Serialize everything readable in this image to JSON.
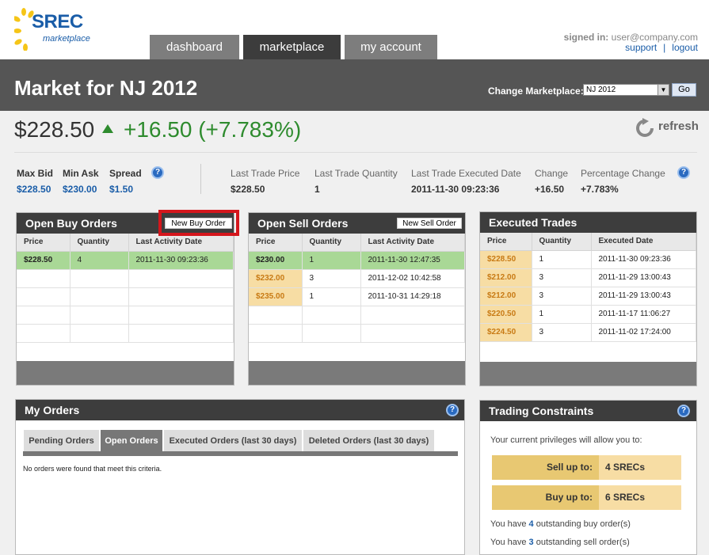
{
  "logo": {
    "text1": "SREC",
    "text2": "marketplace"
  },
  "nav": {
    "tabs": [
      {
        "label": "dashboard",
        "active": false
      },
      {
        "label": "marketplace",
        "active": true
      },
      {
        "label": "my account",
        "active": false
      }
    ]
  },
  "user": {
    "signed_in_label": "signed in:",
    "email": "user@company.com",
    "support": "support",
    "separator": "|",
    "logout": "logout"
  },
  "market": {
    "title": "Market for NJ 2012",
    "change_label": "Change Marketplace:",
    "selected_market": "NJ 2012",
    "go_label": "Go",
    "price": "$228.50",
    "change": "+16.50 (+7.783%)",
    "refresh_label": "refresh"
  },
  "stats": {
    "max_bid_label": "Max Bid",
    "max_bid": "$228.50",
    "min_ask_label": "Min Ask",
    "min_ask": "$230.00",
    "spread_label": "Spread",
    "spread": "$1.50",
    "last_trade_price_label": "Last Trade Price",
    "last_trade_price": "$228.50",
    "last_trade_qty_label": "Last Trade Quantity",
    "last_trade_qty": "1",
    "last_trade_date_label": "Last Trade Executed Date",
    "last_trade_date": "2011-11-30 09:23:36",
    "change_label": "Change",
    "change": "+16.50",
    "pct_change_label": "Percentage Change",
    "pct_change": "+7.783%",
    "help": "?"
  },
  "buy_orders": {
    "title": "Open Buy Orders",
    "button": "New Buy Order",
    "columns": [
      "Price",
      "Quantity",
      "Last Activity Date"
    ],
    "rows": [
      [
        "$228.50",
        "4",
        "2011-11-30 09:23:36"
      ]
    ]
  },
  "sell_orders": {
    "title": "Open Sell Orders",
    "button": "New Sell Order",
    "columns": [
      "Price",
      "Quantity",
      "Last Activity Date"
    ],
    "rows": [
      [
        "$230.00",
        "1",
        "2011-11-30 12:47:35"
      ],
      [
        "$232.00",
        "3",
        "2011-12-02 10:42:58"
      ],
      [
        "$235.00",
        "1",
        "2011-10-31 14:29:18"
      ]
    ]
  },
  "executed": {
    "title": "Executed Trades",
    "columns": [
      "Price",
      "Quantity",
      "Executed Date"
    ],
    "rows": [
      [
        "$228.50",
        "1",
        "2011-11-30 09:23:36"
      ],
      [
        "$212.00",
        "3",
        "2011-11-29 13:00:43"
      ],
      [
        "$212.00",
        "3",
        "2011-11-29 13:00:43"
      ],
      [
        "$220.50",
        "1",
        "2011-11-17 11:06:27"
      ],
      [
        "$224.50",
        "3",
        "2011-11-02 17:24:00"
      ]
    ]
  },
  "my_orders": {
    "title": "My Orders",
    "tabs": [
      "Pending Orders",
      "Open Orders",
      "Executed Orders (last 30 days)",
      "Deleted Orders (last 30 days)"
    ],
    "empty": "No orders were found that meet this criteria."
  },
  "constraints": {
    "title": "Trading Constraints",
    "intro": "Your current privileges will allow you to:",
    "sell_label": "Sell up to:",
    "sell_value": "4 SRECs",
    "buy_label": "Buy up to:",
    "buy_value": "6 SRECs",
    "note1_pre": "You have",
    "note1_num": "4",
    "note1_post": "outstanding buy order(s)",
    "note2_pre": "You have",
    "note2_num": "3",
    "note2_post": "outstanding sell order(s)"
  },
  "colors": {
    "accent_blue": "#1a5da8",
    "up_green": "#2e8b2e",
    "highlight_red": "#d4161c"
  }
}
